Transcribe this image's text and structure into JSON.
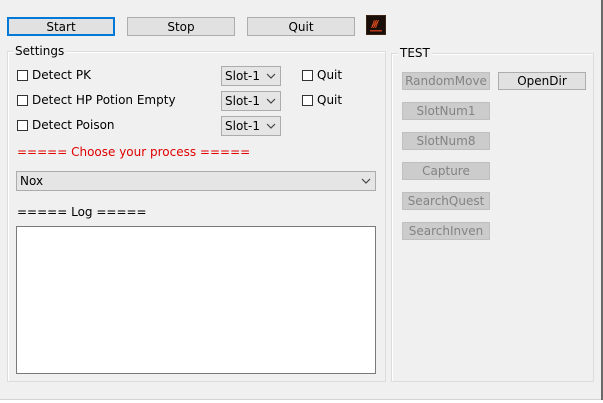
{
  "toolbar": {
    "start_label": "Start",
    "stop_label": "Stop",
    "quit_label": "Quit",
    "logo_icon": "game-logo-icon"
  },
  "settings": {
    "title": "Settings",
    "rows": [
      {
        "label": "Detect PK",
        "slot": "Slot-1",
        "quit_label": "Quit",
        "checked": false
      },
      {
        "label": "Detect HP Potion Empty",
        "slot": "Slot-1",
        "quit_label": "Quit",
        "checked": false
      },
      {
        "label": "Detect Poison",
        "slot": "Slot-1",
        "checked": false
      }
    ],
    "choose_process_label": "===== Choose your process =====",
    "process_selected": "Nox",
    "log_label": "===== Log =====",
    "log_text": ""
  },
  "test": {
    "title": "TEST",
    "buttons": {
      "random_move": "RandomMove",
      "open_dir": "OpenDir",
      "slot_num1": "SlotNum1",
      "slot_num8": "SlotNum8",
      "capture": "Capture",
      "search_quest": "SearchQuest",
      "search_inven": "SearchInven"
    }
  },
  "colors": {
    "background": "#f0f0f0",
    "accent_focus": "#0078d7",
    "warning_text": "#e00000",
    "disabled_text": "#838383"
  }
}
